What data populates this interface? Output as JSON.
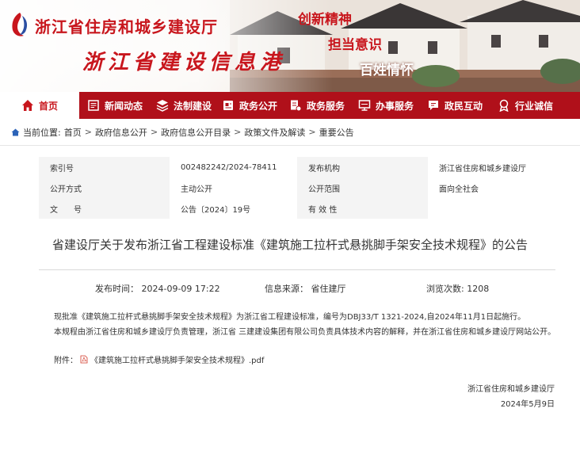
{
  "header": {
    "dept_name": "浙江省住房和城乡建设厅",
    "portal_name": "浙江省建设信息港",
    "slogans": [
      "创新精神",
      "担当意识",
      "百姓情怀"
    ],
    "brand_color": "#c8161d"
  },
  "nav": {
    "items": [
      {
        "label": "首页",
        "icon": "home-icon"
      },
      {
        "label": "新闻动态",
        "icon": "newspaper-icon"
      },
      {
        "label": "法制建设",
        "icon": "layers-icon"
      },
      {
        "label": "政务公开",
        "icon": "document-icon"
      },
      {
        "label": "政务服务",
        "icon": "service-icon"
      },
      {
        "label": "办事服务",
        "icon": "monitor-icon"
      },
      {
        "label": "政民互动",
        "icon": "chat-icon"
      },
      {
        "label": "行业诚信",
        "icon": "badge-icon"
      }
    ]
  },
  "breadcrumb": {
    "prefix": "当前位置:",
    "items": [
      "首页",
      "政府信息公开",
      "政府信息公开目录",
      "政策文件及解读",
      "重要公告"
    ]
  },
  "meta": {
    "index_label": "索引号",
    "index_value": "002482242/2024-78411",
    "issuer_label": "发布机构",
    "issuer_value": "浙江省住房和城乡建设厅",
    "method_label": "公开方式",
    "method_value": "主动公开",
    "scope_label": "公开范围",
    "scope_value": "面向全社会",
    "docno_label": "文　　号",
    "docno_value": "公告〔2024〕19号",
    "validity_label": "有 效 性",
    "validity_value": ""
  },
  "article": {
    "title": "省建设厅关于发布浙江省工程建设标准《建筑施工拉杆式悬挑脚手架安全技术规程》的公告",
    "publish_time": "发布时间： 2024-09-09 17:22",
    "source": "信息来源： 省住建厅",
    "views": "浏览次数: 1208",
    "para1": "现批准《建筑施工拉杆式悬挑脚手架安全技术规程》为浙江省工程建设标准，编号为DBJ33/T 1321-2024,自2024年11月1日起施行。",
    "para2": "本规程由浙江省住房和城乡建设厅负责管理，浙江省 三建建设集团有限公司负责具体技术内容的解释，并在浙江省住房和城乡建设厅网站公开。",
    "attach_label": "附件：",
    "attach_file": "《建筑施工拉杆式悬挑脚手架安全技术规程》.pdf",
    "signer": "浙江省住房和城乡建设厅",
    "sign_date": "2024年5月9日"
  }
}
